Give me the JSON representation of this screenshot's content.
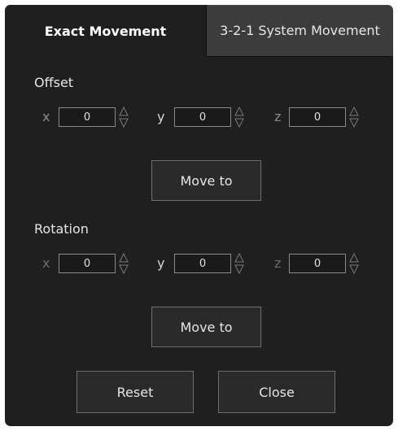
{
  "tabs": {
    "exact": "Exact Movement",
    "system": "3-2-1 System  Movement"
  },
  "offset": {
    "title": "Offset",
    "x_label": "x",
    "x_value": "0",
    "y_label": "y",
    "y_value": "0",
    "z_label": "z",
    "z_value": "0",
    "move_label": "Move to"
  },
  "rotation": {
    "title": "Rotation",
    "x_label": "x",
    "x_value": "0",
    "y_label": "y",
    "y_value": "0",
    "z_label": "z",
    "z_value": "0",
    "move_label": "Move to"
  },
  "footer": {
    "reset_label": "Reset",
    "close_label": "Close"
  }
}
